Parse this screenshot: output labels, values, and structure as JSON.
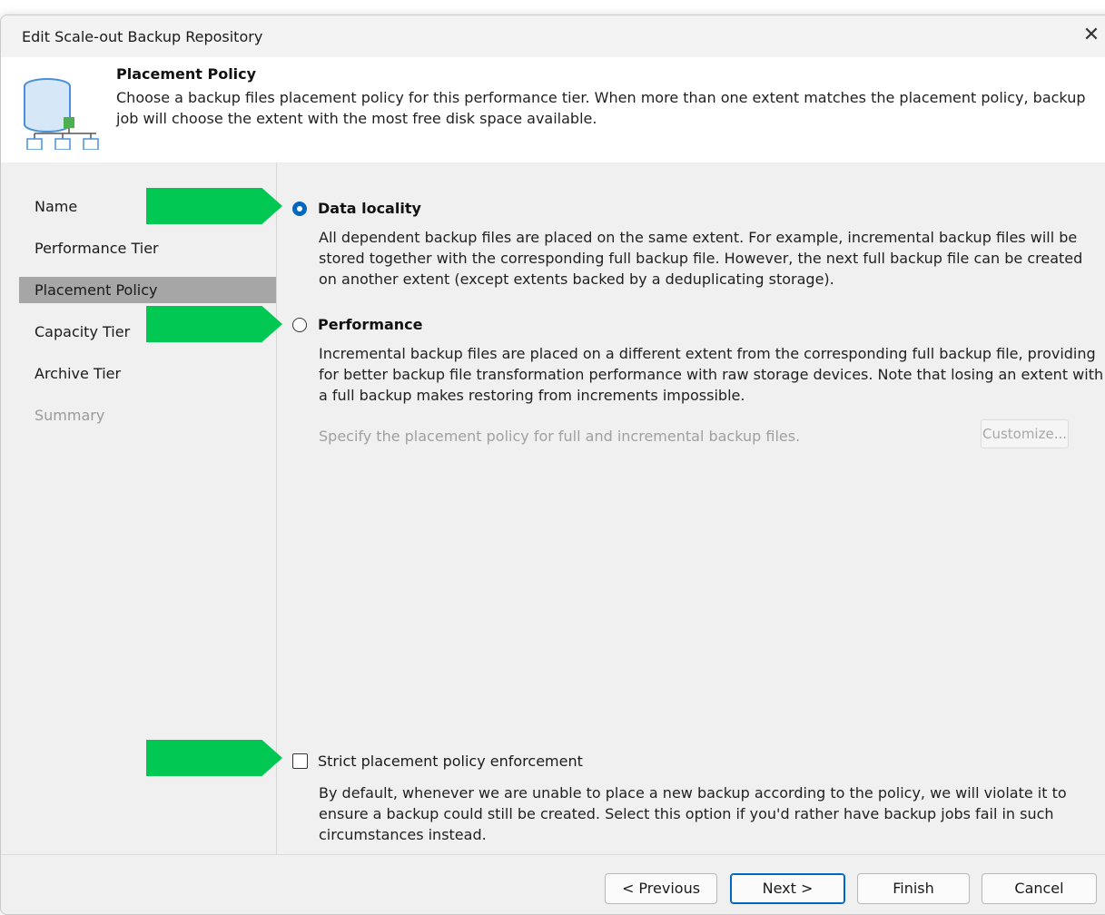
{
  "window": {
    "title": "Edit Scale-out Backup Repository",
    "close_glyph": "✕"
  },
  "header": {
    "title": "Placement Policy",
    "description": "Choose a backup files placement policy for this performance tier. When more than one extent matches the placement policy, backup job will choose the extent with the most free disk space available.",
    "icon": "database-network-icon"
  },
  "sidebar": {
    "items": [
      {
        "label": "Name",
        "state": "normal"
      },
      {
        "label": "Performance Tier",
        "state": "normal"
      },
      {
        "label": "Placement Policy",
        "state": "active"
      },
      {
        "label": "Capacity Tier",
        "state": "normal"
      },
      {
        "label": "Archive Tier",
        "state": "normal"
      },
      {
        "label": "Summary",
        "state": "disabled"
      }
    ]
  },
  "options": {
    "data_locality": {
      "label": "Data locality",
      "selected": true,
      "description": "All dependent backup files are placed on the same extent. For example, incremental backup files will be stored together with the corresponding full backup file. However, the next full backup file can be created on another extent (except extents backed by a deduplicating storage)."
    },
    "performance": {
      "label": "Performance",
      "selected": false,
      "description": "Incremental backup files are placed on a different extent from the corresponding full backup file, providing for better backup file transformation performance with raw storage devices. Note that losing an extent with a full backup makes restoring from increments impossible.",
      "hint": "Specify the placement policy for full and incremental backup files.",
      "customize_label": "Customize..."
    }
  },
  "strict": {
    "label": "Strict placement policy enforcement",
    "checked": false,
    "description": "By default, whenever we are unable to place a new backup according to the policy, we will violate it to ensure a backup could still be created. Select this option if you'd rather have backup jobs fail in such circumstances instead."
  },
  "footer": {
    "previous_label": "< Previous",
    "next_label": "Next >",
    "finish_label": "Finish",
    "cancel_label": "Cancel"
  },
  "colors": {
    "accent": "#0067c0",
    "highlight_arrow": "#00c853",
    "active_nav": "#a6a6a6",
    "icon_db": "#4a90d9",
    "icon_node": "#4caf50"
  }
}
